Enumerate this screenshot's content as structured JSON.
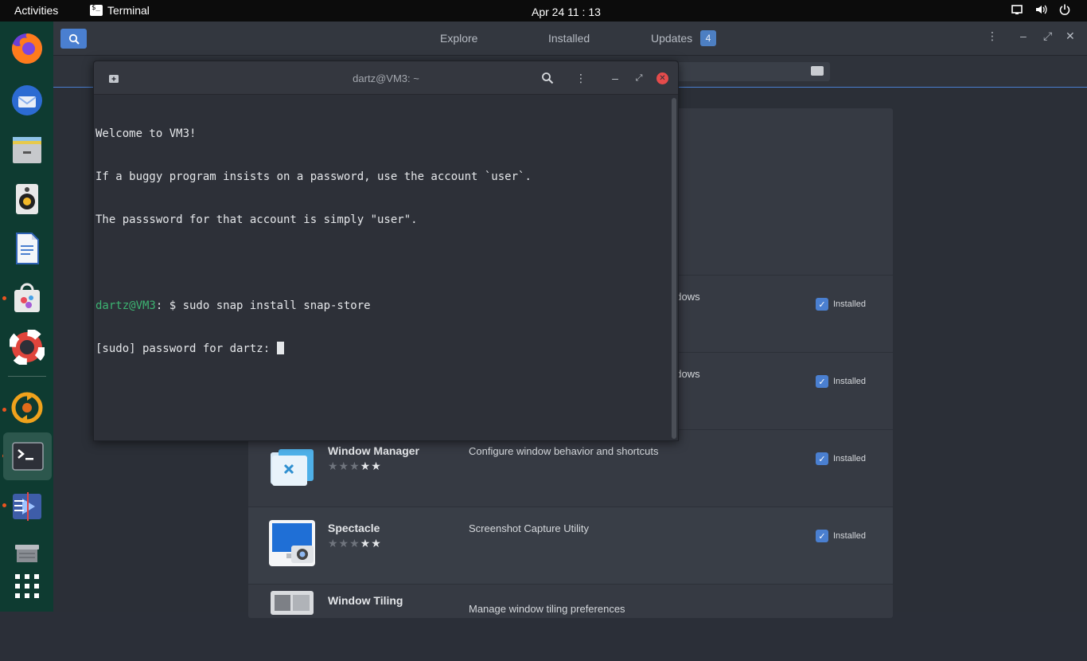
{
  "topbar": {
    "activities": "Activities",
    "app_name": "Terminal",
    "clock": "Apr 24  11 : 13"
  },
  "software": {
    "tabs": [
      "Explore",
      "Installed",
      "Updates"
    ],
    "updates_count": "4",
    "apps": [
      {
        "name": "",
        "desc": "ndows",
        "status": "Installed"
      },
      {
        "name": "",
        "desc": "ndows",
        "status": "Installed"
      },
      {
        "name": "Window Manager",
        "desc": "Configure window behavior and shortcuts",
        "status": "Installed",
        "rating": 2
      },
      {
        "name": "Spectacle",
        "desc": "Screenshot Capture Utility",
        "status": "Installed",
        "rating": 2
      },
      {
        "name": "Window Tiling",
        "desc": "Manage window tiling preferences",
        "status": ""
      }
    ]
  },
  "terminal": {
    "title": "dartz@VM3: ~",
    "lines": [
      "Welcome to VM3!",
      "If a buggy program insists on a password, use the account `user`.",
      "The passsword for that account is simply \"user\"."
    ],
    "prompt_user": "dartz@VM3",
    "prompt_rest": ": $ sudo snap install snap-store",
    "sudo_line": "[sudo] password for dartz: "
  },
  "colors": {
    "accent": "#4a7fd0",
    "dock": "#0e3b31",
    "prompt": "#3cb371",
    "close": "#e54b4b"
  }
}
